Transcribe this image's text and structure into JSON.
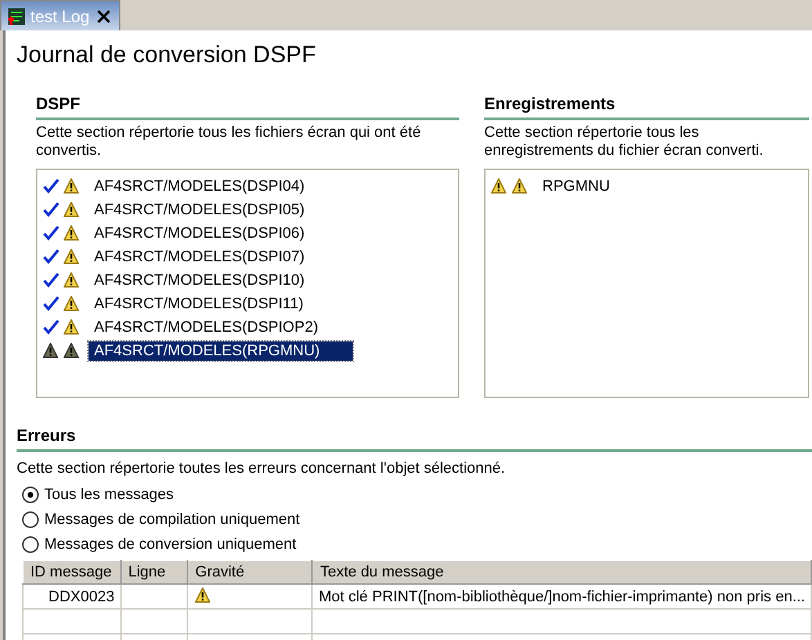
{
  "tab": {
    "title": "test Log"
  },
  "title": "Journal de conversion DSPF",
  "dspf": {
    "heading": "DSPF",
    "description": "Cette section répertorie tous les fichiers écran qui ont été convertis.",
    "items": [
      {
        "label": "AF4SRCT/MODELES(DSPI04)",
        "kind": "converted",
        "selected": false
      },
      {
        "label": "AF4SRCT/MODELES(DSPI05)",
        "kind": "converted",
        "selected": false
      },
      {
        "label": "AF4SRCT/MODELES(DSPI06)",
        "kind": "converted",
        "selected": false
      },
      {
        "label": "AF4SRCT/MODELES(DSPI07)",
        "kind": "converted",
        "selected": false
      },
      {
        "label": "AF4SRCT/MODELES(DSPI10)",
        "kind": "converted",
        "selected": false
      },
      {
        "label": "AF4SRCT/MODELES(DSPI11)",
        "kind": "converted",
        "selected": false
      },
      {
        "label": "AF4SRCT/MODELES(DSPIOP2)",
        "kind": "converted",
        "selected": false
      },
      {
        "label": "AF4SRCT/MODELES(RPGMNU)",
        "kind": "warned",
        "selected": true
      }
    ]
  },
  "records": {
    "heading": "Enregistrements",
    "description": "Cette section répertorie tous les enregistrements du fichier écran converti.",
    "items": [
      {
        "label": "RPGMNU",
        "kind": "warned",
        "selected": false
      }
    ]
  },
  "errors": {
    "heading": "Erreurs",
    "description": "Cette section répertorie toutes les erreurs concernant l'objet sélectionné.",
    "filters": [
      {
        "label": "Tous les messages",
        "selected": true
      },
      {
        "label": "Messages de compilation uniquement",
        "selected": false
      },
      {
        "label": "Messages de conversion uniquement",
        "selected": false
      }
    ],
    "table": {
      "columns": [
        "ID message",
        "Ligne",
        "Gravité",
        "Texte du message"
      ],
      "rows": [
        {
          "id": "DDX0023",
          "kind": "warning",
          "text": "Mot clé PRINT([nom-bibliothèque/]nom-fichier-imprimante) non pris en..."
        }
      ]
    }
  }
}
